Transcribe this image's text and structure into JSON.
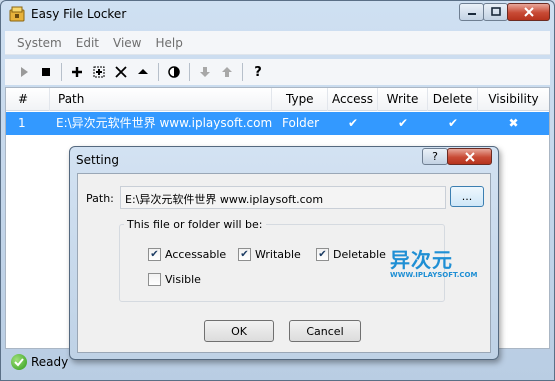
{
  "window": {
    "title": "Easy File Locker"
  },
  "menu": [
    "System",
    "Edit",
    "View",
    "Help"
  ],
  "toolbar": [
    "play-icon",
    "stop-icon",
    "add-icon",
    "add-folder-icon",
    "delete-icon",
    "eject-icon",
    "contrast-icon",
    "move-down-icon",
    "move-up-icon",
    "help-icon"
  ],
  "list": {
    "columns": [
      "#",
      "Path",
      "Type",
      "Access",
      "Write",
      "Delete",
      "Visibility"
    ],
    "rows": [
      {
        "num": "1",
        "path": "E:\\异次元软件世界 www.iplaysoft.com",
        "type": "Folder",
        "access": "✔",
        "write": "✔",
        "delete": "✔",
        "visibility": "✖"
      }
    ]
  },
  "status": {
    "text": "Ready"
  },
  "dialog": {
    "title": "Setting",
    "help_label": "?",
    "path_label": "Path:",
    "path_value": "E:\\异次元软件世界 www.iplaysoft.com",
    "browse_label": "...",
    "group_label": "This file or folder will be:",
    "checkboxes": [
      {
        "label": "Accessable",
        "checked": true
      },
      {
        "label": "Writable",
        "checked": true
      },
      {
        "label": "Deletable",
        "checked": true
      },
      {
        "label": "Visible",
        "checked": false
      }
    ],
    "logo_cn": "异次元",
    "logo_en": "WWW.IPLAYSOFT.COM",
    "ok_label": "OK",
    "cancel_label": "Cancel"
  },
  "colors": {
    "selection": "#3399ff",
    "accent": "#3c7fb1"
  }
}
